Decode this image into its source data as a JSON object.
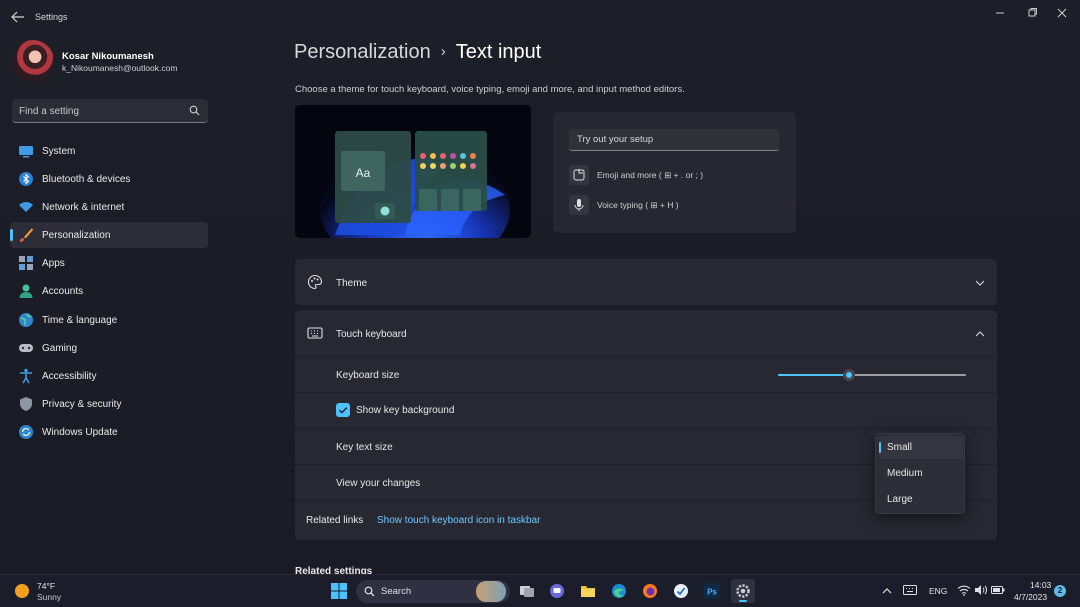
{
  "window": {
    "title": "Settings"
  },
  "profile": {
    "name": "Kosar Nikoumanesh",
    "email": "k_Nikoumanesh@outlook.com"
  },
  "search": {
    "placeholder": "Find a setting"
  },
  "nav": {
    "items": [
      {
        "label": "System",
        "icon": "system-icon",
        "active": false
      },
      {
        "label": "Bluetooth & devices",
        "icon": "bluetooth-icon",
        "active": false
      },
      {
        "label": "Network & internet",
        "icon": "wifi-icon",
        "active": false
      },
      {
        "label": "Personalization",
        "icon": "brush-icon",
        "active": true
      },
      {
        "label": "Apps",
        "icon": "apps-icon",
        "active": false
      },
      {
        "label": "Accounts",
        "icon": "account-icon",
        "active": false
      },
      {
        "label": "Time & language",
        "icon": "globe-icon",
        "active": false
      },
      {
        "label": "Gaming",
        "icon": "gamepad-icon",
        "active": false
      },
      {
        "label": "Accessibility",
        "icon": "accessibility-icon",
        "active": false
      },
      {
        "label": "Privacy & security",
        "icon": "shield-icon",
        "active": false
      },
      {
        "label": "Windows Update",
        "icon": "update-icon",
        "active": false
      }
    ]
  },
  "header": {
    "parent": "Personalization",
    "current": "Text input",
    "description": "Choose a theme for touch keyboard, voice typing, emoji and more, and input method editors."
  },
  "preview": {
    "sample_text": "Aa"
  },
  "tryout": {
    "placeholder": "Try out your setup",
    "emoji_tip": "Emoji and more ( ⊞ + . or ; )",
    "voice_tip": "Voice typing ( ⊞ + H )"
  },
  "theme_card": {
    "title": "Theme"
  },
  "keyboard_card": {
    "title": "Touch keyboard",
    "keyboard_size_label": "Keyboard size",
    "keyboard_size_fraction": 0.38,
    "show_key_background_label": "Show key background",
    "show_key_background_checked": true,
    "key_text_size_label": "Key text size",
    "view_changes_label": "View your changes",
    "related_links_label": "Related links",
    "related_link": "Show touch keyboard icon in taskbar"
  },
  "key_text_size_dropdown": {
    "options": [
      "Small",
      "Medium",
      "Large"
    ],
    "selected": "Small"
  },
  "related_settings": {
    "title": "Related settings"
  },
  "taskbar": {
    "weather_temp": "74°F",
    "weather_condition": "Sunny",
    "search_label": "Search",
    "language": "ENG",
    "time": "14:03",
    "date": "4/7/2023",
    "notification_count": "2"
  },
  "colors": {
    "accent": "#4cc2ff",
    "background": "#1c1e28",
    "card": "#272832"
  }
}
